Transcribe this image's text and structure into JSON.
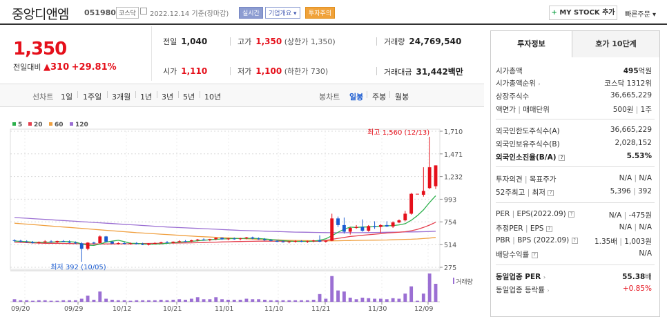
{
  "header": {
    "name": "중앙디앤엠",
    "code": "051980",
    "market": "코스닥",
    "date": "2022.12.14 기준(장마감)",
    "tags": [
      "실시간",
      "기업개요 ▾",
      "투자주의"
    ],
    "mystock": "MY STOCK 추가",
    "quick": "빠른주문 ▾"
  },
  "price": {
    "current": "1,350",
    "change_label": "전일대비",
    "change_value": "310",
    "change_pct": "+29.81%"
  },
  "summary": {
    "prev_label": "전일",
    "prev": "1,040",
    "high_label": "고가",
    "high": "1,350",
    "high_sub": "(상한가 1,350)",
    "volume_label": "거래량",
    "volume": "24,769,540",
    "open_label": "시가",
    "open": "1,110",
    "low_label": "저가",
    "low": "1,100",
    "low_sub": "(하한가 730)",
    "amount_label": "거래대금",
    "amount": "31,442",
    "amount_unit": "백만"
  },
  "periods": {
    "line_label": "선차트",
    "line_items": [
      "1일",
      "1주일",
      "3개월",
      "1년",
      "3년",
      "5년",
      "10년"
    ],
    "candle_label": "봉차트",
    "candle_items": [
      "일봉",
      "주봉",
      "월봉"
    ],
    "candle_selected": "일봉"
  },
  "side": {
    "tabs": [
      "투자정보",
      "호가 10단계"
    ],
    "rows1": [
      {
        "k": "시가총액",
        "v": "495",
        "unit": "억원"
      },
      {
        "k": "시가총액순위",
        "v": "코스닥 1312위"
      },
      {
        "k": "상장주식수",
        "v": "36,665,229"
      },
      {
        "k": "액면가",
        "k2": "매매단위",
        "v": "500원",
        "v2": "1주"
      }
    ],
    "rows2": [
      {
        "k": "외국인한도주식수(A)",
        "v": "36,665,229"
      },
      {
        "k": "외국인보유주식수(B)",
        "v": "2,028,152"
      },
      {
        "k": "외국인소진율(B/A)",
        "v": "5.53%"
      }
    ],
    "rows3": [
      {
        "k": "투자의견",
        "k2": "목표주가",
        "v": "N/A",
        "v2": "N/A"
      },
      {
        "k": "52주최고",
        "k2": "최저",
        "v": "5,396",
        "v2": "392"
      }
    ],
    "rows4": [
      {
        "k": "PER",
        "k2": "EPS(2022.09)",
        "v": "N/A",
        "v2": "-475원"
      },
      {
        "k": "추정PER",
        "k2": "EPS",
        "v": "N/A",
        "v2": "N/A"
      },
      {
        "k": "PBR",
        "k2": "BPS (2022.09)",
        "v": "1.35배",
        "v2": "1,003원"
      },
      {
        "k": "배당수익률",
        "v": "N/A"
      }
    ],
    "rows5": [
      {
        "k": "동일업종 PER",
        "v": "55.38",
        "unit": "배"
      },
      {
        "k": "동일업종 등락률",
        "v": "+0.85%"
      }
    ]
  },
  "chart_data": {
    "type": "candlestick",
    "ma_legend": [
      {
        "name": "5",
        "color": "#2cb04c"
      },
      {
        "name": "20",
        "color": "#e5404f"
      },
      {
        "name": "60",
        "color": "#f0a040"
      },
      {
        "name": "120",
        "color": "#9b6fd3"
      }
    ],
    "y_ticks": [
      "1,710",
      "1,471",
      "1,232",
      "993",
      "754",
      "514",
      "275"
    ],
    "ylim": [
      275,
      1710
    ],
    "x_labels": [
      "09/20",
      "09/29",
      "10/12",
      "10/21",
      "11/01",
      "11/10",
      "11/21",
      "11/30",
      "12/09"
    ],
    "annotation_high": "최고 1,560 (12/13)",
    "annotation_low": "최저 392 (10/05)",
    "volume_label": "거래량",
    "candles": [
      [
        560,
        570,
        540,
        555
      ],
      [
        555,
        565,
        540,
        545
      ],
      [
        545,
        560,
        535,
        540
      ],
      [
        540,
        552,
        525,
        530
      ],
      [
        530,
        548,
        520,
        540
      ],
      [
        540,
        560,
        530,
        548
      ],
      [
        548,
        560,
        535,
        540
      ],
      [
        540,
        556,
        530,
        552
      ],
      [
        552,
        562,
        540,
        545
      ],
      [
        545,
        558,
        530,
        535
      ],
      [
        535,
        548,
        520,
        528
      ],
      [
        528,
        540,
        440,
        470
      ],
      [
        470,
        540,
        455,
        535
      ],
      [
        535,
        545,
        520,
        530
      ],
      [
        530,
        612,
        525,
        600
      ],
      [
        600,
        606,
        540,
        545
      ],
      [
        545,
        552,
        520,
        525
      ],
      [
        525,
        540,
        515,
        530
      ],
      [
        530,
        542,
        518,
        522
      ],
      [
        522,
        536,
        512,
        528
      ],
      [
        528,
        540,
        515,
        520
      ],
      [
        520,
        534,
        508,
        512
      ],
      [
        512,
        530,
        505,
        525
      ],
      [
        525,
        540,
        515,
        530
      ],
      [
        530,
        545,
        520,
        538
      ],
      [
        538,
        552,
        528,
        532
      ],
      [
        532,
        548,
        525,
        545
      ],
      [
        545,
        560,
        535,
        550
      ],
      [
        550,
        562,
        540,
        548
      ],
      [
        548,
        565,
        542,
        560
      ],
      [
        560,
        574,
        548,
        568
      ],
      [
        568,
        580,
        555,
        562
      ],
      [
        562,
        575,
        550,
        572
      ],
      [
        572,
        590,
        560,
        585
      ],
      [
        585,
        592,
        565,
        570
      ],
      [
        570,
        585,
        560,
        578
      ],
      [
        578,
        590,
        566,
        572
      ],
      [
        572,
        586,
        560,
        580
      ],
      [
        580,
        595,
        570,
        590
      ],
      [
        590,
        598,
        570,
        578
      ],
      [
        578,
        590,
        565,
        570
      ],
      [
        570,
        582,
        556,
        560
      ],
      [
        560,
        574,
        548,
        552
      ],
      [
        552,
        566,
        540,
        548
      ],
      [
        548,
        560,
        535,
        540
      ],
      [
        540,
        552,
        528,
        548
      ],
      [
        548,
        560,
        535,
        552
      ],
      [
        552,
        560,
        540,
        545
      ],
      [
        545,
        556,
        532,
        550
      ],
      [
        550,
        565,
        540,
        558
      ],
      [
        558,
        612,
        540,
        545
      ],
      [
        545,
        560,
        535,
        555
      ],
      [
        555,
        840,
        550,
        790
      ],
      [
        790,
        810,
        700,
        720
      ],
      [
        720,
        800,
        630,
        650
      ],
      [
        650,
        700,
        620,
        690
      ],
      [
        690,
        720,
        680,
        700
      ],
      [
        700,
        780,
        650,
        660
      ],
      [
        660,
        720,
        650,
        710
      ],
      [
        710,
        760,
        680,
        700
      ],
      [
        700,
        730,
        640,
        720
      ],
      [
        720,
        760,
        700,
        705
      ],
      [
        705,
        760,
        690,
        748
      ],
      [
        748,
        780,
        740,
        770
      ],
      [
        770,
        870,
        760,
        840
      ],
      [
        840,
        1060,
        830,
        1050
      ],
      [
        1050,
        1050,
        1050,
        1050
      ],
      [
        1040,
        1330,
        1020,
        1080
      ],
      [
        1110,
        1560,
        1100,
        1330
      ],
      [
        1130,
        1350,
        1100,
        1350
      ]
    ],
    "volumes": [
      0.5,
      0.3,
      0.3,
      0.2,
      0.3,
      0.3,
      0.2,
      0.2,
      0.3,
      0.3,
      0.3,
      0.6,
      1.2,
      0.4,
      2.0,
      0.6,
      0.4,
      0.3,
      0.3,
      0.2,
      0.3,
      0.3,
      0.3,
      0.3,
      0.4,
      0.3,
      0.4,
      0.5,
      0.4,
      0.6,
      0.9,
      0.5,
      0.5,
      0.9,
      0.5,
      0.4,
      0.4,
      0.4,
      0.6,
      0.5,
      0.5,
      0.4,
      0.3,
      0.3,
      0.3,
      0.3,
      0.3,
      0.3,
      0.3,
      0.4,
      1.5,
      0.6,
      5.0,
      2.2,
      2.0,
      0.8,
      0.5,
      0.8,
      0.7,
      0.6,
      0.6,
      0.5,
      0.7,
      0.6,
      1.6,
      3.0,
      0.2,
      1.6,
      5.5,
      3.5
    ],
    "ma5": [
      552,
      548,
      545,
      540,
      538,
      538,
      540,
      543,
      546,
      545,
      540,
      522,
      508,
      505,
      520,
      540,
      550,
      560,
      545,
      528,
      527,
      522,
      518,
      520,
      522,
      528,
      535,
      540,
      545,
      548,
      555,
      560,
      565,
      570,
      574,
      576,
      578,
      578,
      580,
      580,
      578,
      574,
      568,
      562,
      556,
      550,
      548,
      548,
      548,
      550,
      560,
      575,
      608,
      644,
      677,
      698,
      695,
      700,
      700,
      705,
      710,
      712,
      715,
      722,
      735,
      770,
      820,
      880,
      960,
      1030
    ],
    "ma20": [
      540,
      537,
      535,
      532,
      530,
      528,
      528,
      527,
      526,
      525,
      524,
      523,
      522,
      521,
      521,
      521,
      521,
      522,
      522,
      523,
      524,
      525,
      526,
      527,
      528,
      529,
      530,
      531,
      532,
      533,
      534,
      536,
      538,
      540,
      542,
      544,
      546,
      547,
      548,
      549,
      550,
      550,
      550,
      550,
      550,
      549,
      548,
      548,
      548,
      548,
      550,
      558,
      570,
      580,
      590,
      600,
      606,
      612,
      618,
      624,
      630,
      636,
      640,
      645,
      650,
      660,
      675,
      695,
      720,
      750
    ],
    "ma60": [
      740,
      735,
      730,
      725,
      720,
      715,
      710,
      705,
      700,
      695,
      690,
      685,
      680,
      675,
      670,
      665,
      660,
      655,
      650,
      645,
      640,
      636,
      632,
      628,
      624,
      620,
      616,
      612,
      608,
      604,
      600,
      597,
      594,
      591,
      588,
      585,
      582,
      579,
      576,
      573,
      570,
      568,
      566,
      564,
      562,
      560,
      558,
      557,
      556,
      555,
      554,
      554,
      554,
      555,
      556,
      557,
      558,
      559,
      560,
      561,
      562,
      563,
      565,
      567,
      569,
      571,
      574,
      578,
      583,
      590
    ],
    "ma120": [
      800,
      796,
      792,
      788,
      784,
      780,
      776,
      772,
      768,
      764,
      760,
      756,
      752,
      748,
      744,
      740,
      736,
      732,
      728,
      724,
      720,
      716,
      712,
      708,
      704,
      700,
      697,
      694,
      691,
      688,
      685,
      682,
      679,
      676,
      673,
      670,
      667,
      664,
      662,
      660,
      658,
      656,
      654,
      652,
      650,
      648,
      646,
      645,
      644,
      643,
      642,
      641,
      640,
      640,
      640,
      640,
      640,
      640,
      641,
      642,
      643,
      644,
      645,
      646,
      647,
      648,
      649,
      650,
      652,
      655
    ]
  }
}
